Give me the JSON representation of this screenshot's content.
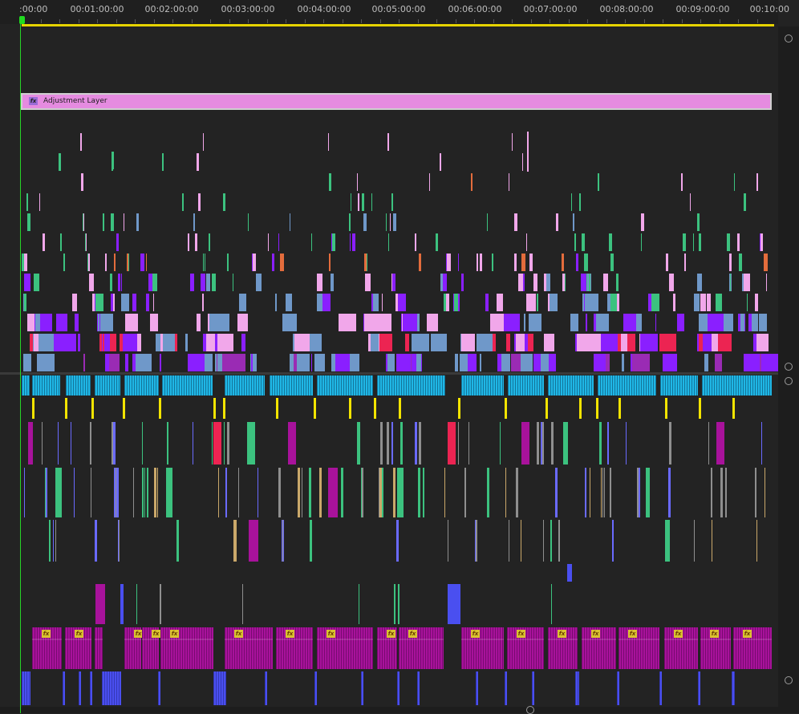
{
  "timeline": {
    "ruler_labels": [
      ":00:00",
      "00:01:00:00",
      "00:02:00:00",
      "00:03:00:00",
      "00:04:00:00",
      "00:05:00:00",
      "00:06:00:00",
      "00:07:00:00",
      "00:08:00:00",
      "00:09:00:00",
      "00:10:00"
    ],
    "adjustment_layer": {
      "label": "Adjustment Layer",
      "fx_label": "fx"
    },
    "audio_fx_label": "fx",
    "colors": {
      "playhead": "#27d427",
      "work_area": "#e6d300",
      "adjustment_layer": "#e58be0",
      "violet": "#8a1fff",
      "steel_blue": "#6f98c9",
      "pink": "#f1a7ea",
      "green": "#3cc27f",
      "cyan_audio": "#1fb7e6",
      "magenta_audio": "#a8129b",
      "blue_audio": "#4a4ff0",
      "yellow": "#f3e400",
      "crimson": "#ec2452"
    }
  }
}
